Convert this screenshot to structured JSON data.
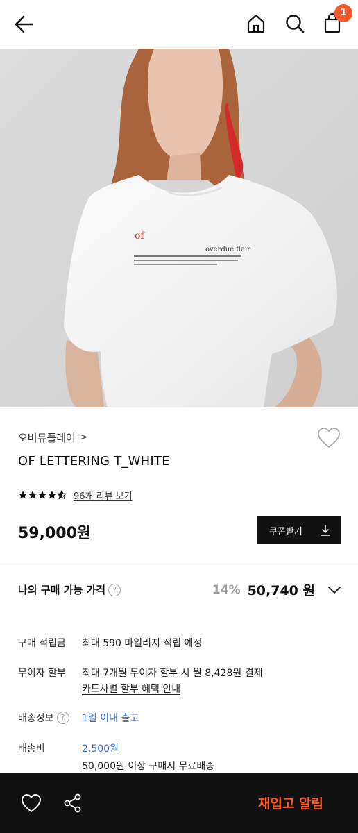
{
  "header": {
    "back_icon": "back-arrow-icon",
    "home_icon": "home-icon",
    "search_icon": "search-icon",
    "cart_icon": "shopping-bag-icon",
    "cart_count": "1",
    "badge_color": "#f4582b"
  },
  "gallery": {
    "shirt_text_of": "of",
    "shirt_text_brand": "overdue flair",
    "slide_progress": 0.25
  },
  "product": {
    "brand": "오버듀플레어",
    "brand_chevron": ">",
    "name": "OF LETTERING T_WHITE",
    "rating": 4.5,
    "review_link": "96개 리뷰 보기",
    "price": "59,000원",
    "coupon_label": "쿠폰받기"
  },
  "my_price": {
    "label": "나의 구매 가능 가격",
    "help": "?",
    "discount": "14%",
    "price": "50,740 원"
  },
  "info": {
    "points_label": "구매 적립금",
    "points_value": "최대 590 마일리지 적립 예정",
    "installment_label": "무이자 할부",
    "installment_value": "최대 7개월 무이자 할부 시 월 8,428원 결제",
    "installment_link": "카드사별 할부 혜택 안내",
    "shipping_label": "배송정보",
    "shipping_help": "?",
    "shipping_value": "1일 이내 출고",
    "fee_label": "배송비",
    "fee_value": "2,500원",
    "fee_note": "50,000원 이상 구매시 무료배송"
  },
  "bottom_bar": {
    "restock_label": "재입고 알림",
    "restock_color": "#ff5a24",
    "heart_icon": "heart-icon",
    "share_icon": "share-icon"
  }
}
